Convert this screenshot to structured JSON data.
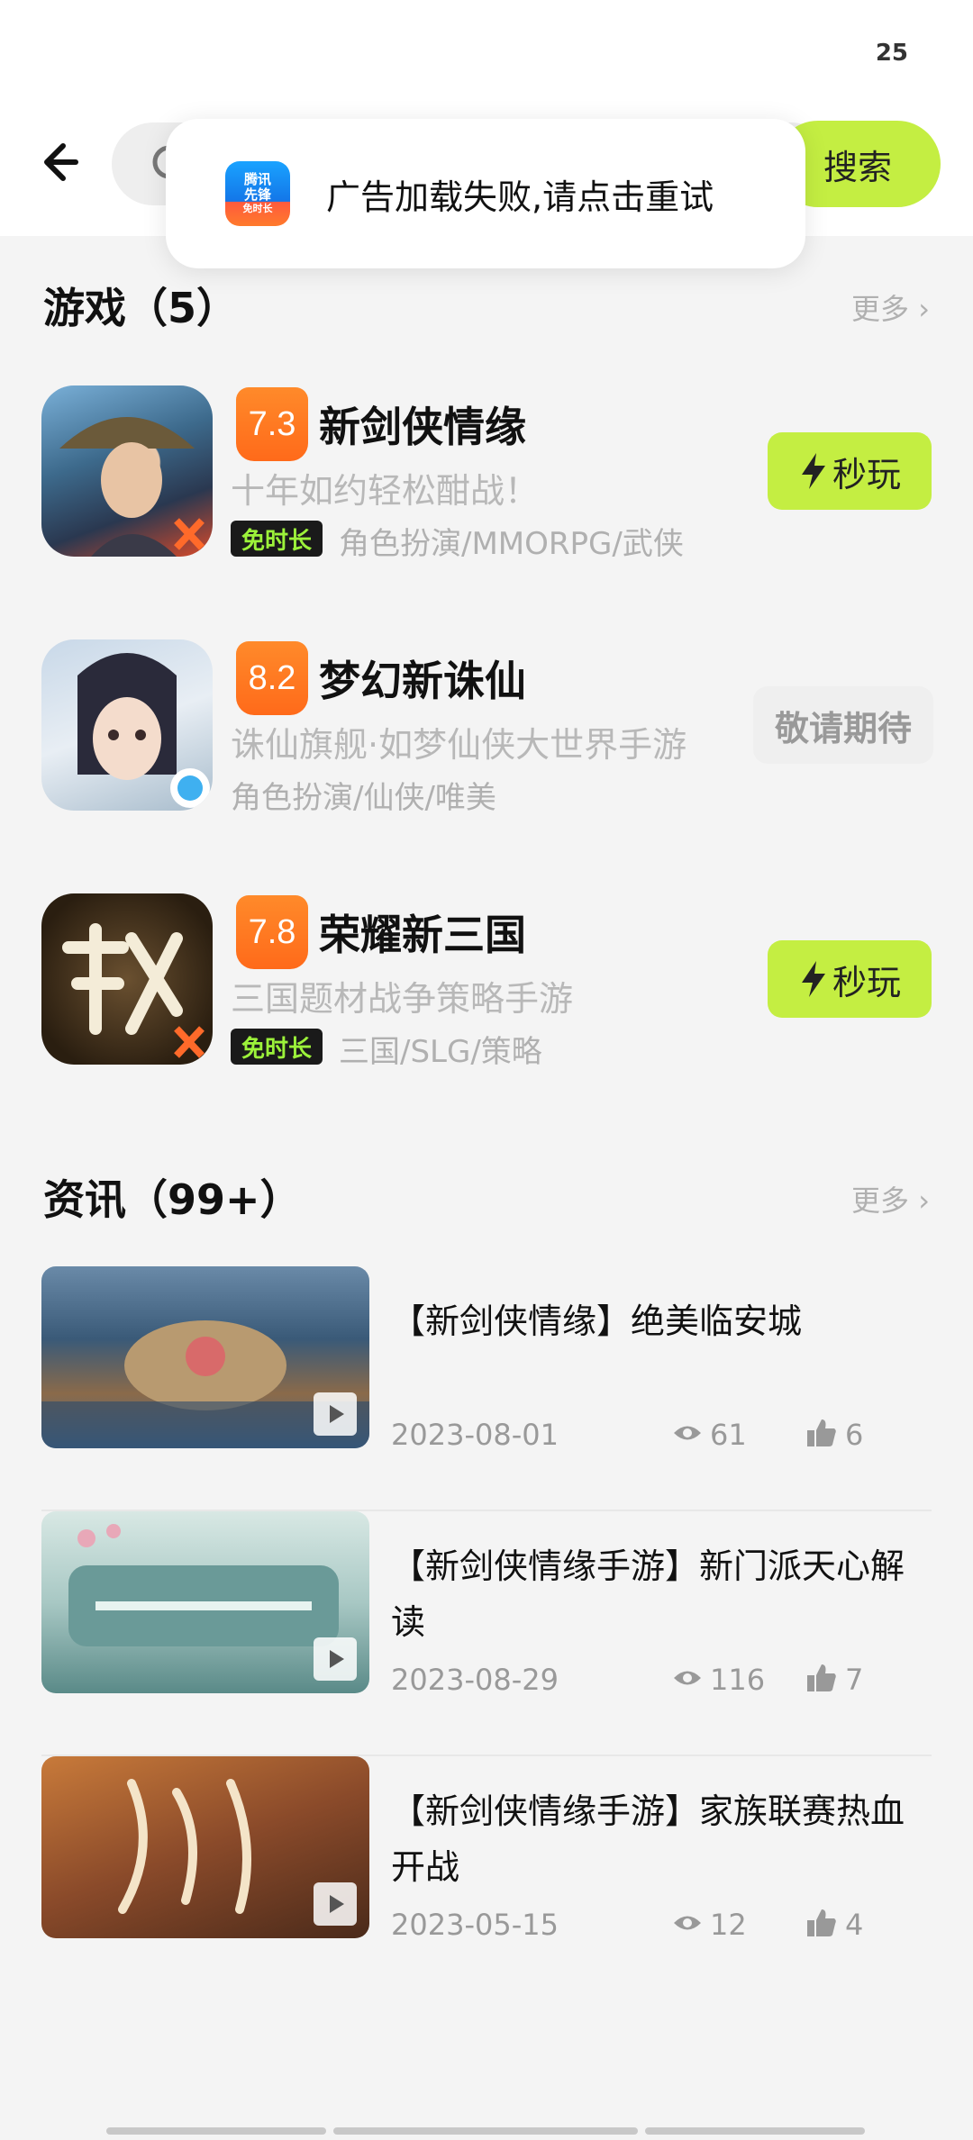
{
  "status": {
    "value": "25"
  },
  "search": {
    "button_label": "搜索"
  },
  "toast": {
    "logo_line1": "腾讯",
    "logo_line2": "先锋",
    "logo_line3": "免时长",
    "message": "广告加载失败,请点击重试"
  },
  "games_section": {
    "title": "游戏（5）",
    "more": "更多 ›"
  },
  "games": [
    {
      "score": "7.3",
      "name": "新剑侠情缘",
      "desc": "十年如约轻松酣战！",
      "badge": "免时长",
      "tags": "角色扮演/MMORPG/武侠",
      "action": "秒玩"
    },
    {
      "score": "8.2",
      "name": "梦幻新诛仙",
      "desc": "诛仙旗舰·如梦仙侠大世界手游",
      "badge": "",
      "tags": "角色扮演/仙侠/唯美",
      "action": "敬请期待"
    },
    {
      "score": "7.8",
      "name": "荣耀新三国",
      "desc": "三国题材战争策略手游",
      "badge": "免时长",
      "tags": "三国/SLG/策略",
      "action": "秒玩"
    }
  ],
  "news_section": {
    "title": "资讯（99+）",
    "more": "更多 ›"
  },
  "news": [
    {
      "title": "【新剑侠情缘】绝美临安城",
      "date": "2023-08-01",
      "views": "61",
      "likes": "6"
    },
    {
      "title": "【新剑侠情缘手游】新门派天心解读",
      "date": "2023-08-29",
      "views": "116",
      "likes": "7"
    },
    {
      "title": "【新剑侠情缘手游】家族联赛热血开战",
      "date": "2023-05-15",
      "views": "12",
      "likes": "4"
    }
  ],
  "colors": {
    "accent": "#c4ee42",
    "score": "#ff7a1f",
    "badge_text": "#9cf23a"
  },
  "icons": [
    "back-arrow-icon",
    "search-icon",
    "lightning-icon",
    "eye-icon",
    "thumbs-up-icon",
    "play-icon"
  ]
}
